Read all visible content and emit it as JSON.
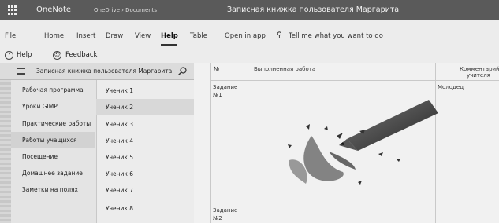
{
  "titlebar": {
    "app_name": "OneNote",
    "breadcrumb": "OneDrive › Documents",
    "window_title": "Записная книжка пользователя Маргарита"
  },
  "menu": {
    "file": "File",
    "home": "Home",
    "insert": "Insert",
    "draw": "Draw",
    "view": "View",
    "help": "Help",
    "table": "Table",
    "open_in_app": "Open in app",
    "tell_me": "Tell me what you want to do"
  },
  "help_row": {
    "help": "Help",
    "feedback": "Feedback"
  },
  "notebook": {
    "name": "Записная книжка пользователя Маргарита"
  },
  "sections": [
    "Рабочая программа",
    "Уроки GIMP",
    "Практические работы",
    "Работы учащихся",
    "Посещение",
    "Домашнее задание",
    "Заметки на полях"
  ],
  "pages": [
    "Ученик 1",
    "Ученик 2",
    "Ученик 3",
    "Ученик 4",
    "Ученик 5",
    "Ученик 6",
    "Ученик 7",
    "Ученик 8"
  ],
  "table": {
    "col_no": "№",
    "col_work": "Выполненная работа",
    "col_comment_line1": "Комментарий",
    "col_comment_line2": "учителя",
    "row1_line1": "Задание",
    "row1_line2": "№1",
    "row1_comment": "Молодец",
    "row2_line1": "Задание",
    "row2_line2": "№2"
  },
  "icons": {
    "app_launcher": "waffle-icon",
    "nav_toggle": "hamburger-icon",
    "search": "search-icon",
    "lightbulb": "lightbulb-icon",
    "help": "help-icon",
    "feedback": "smiley-icon"
  }
}
